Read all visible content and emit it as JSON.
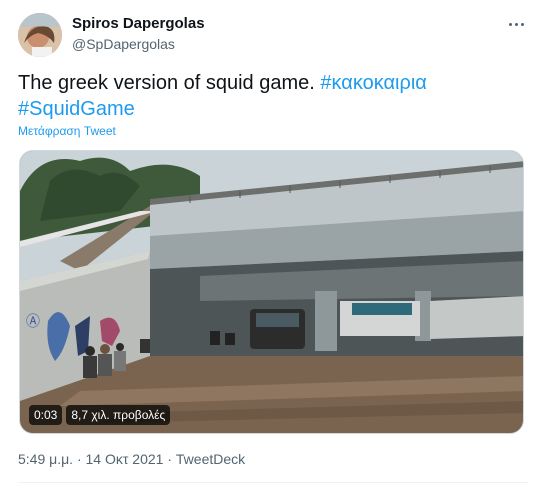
{
  "author": {
    "display_name": "Spiros Dapergolas",
    "handle": "@SpDapergolas",
    "avatar_icon": "profile-avatar"
  },
  "tweet": {
    "text": "The greek version of squid game.",
    "hashtags": [
      "#κακοκαιρια",
      "#SquidGame"
    ],
    "translate_label": "Μετάφραση Tweet"
  },
  "video": {
    "time": "0:03",
    "views": "8,7 χιλ. προβολές"
  },
  "footer": {
    "time": "5:49 μ.μ.",
    "separator": "·",
    "date": "14 Οκτ 2021",
    "source": "TweetDeck"
  },
  "colors": {
    "link": "#1d9bf0",
    "secondary_text": "#536471",
    "primary_text": "#0f1419"
  }
}
